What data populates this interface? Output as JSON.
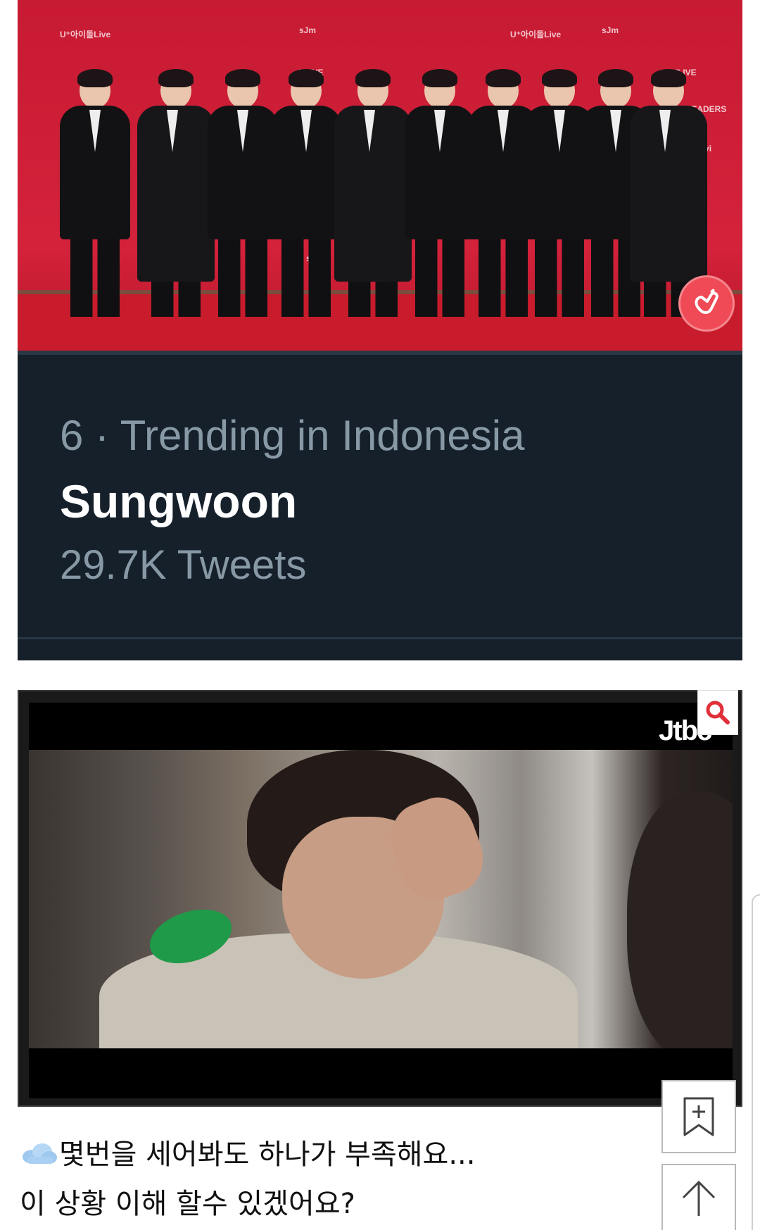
{
  "image1": {
    "backdrop_logos": [
      "sJm",
      "U⁺아이돌Live",
      "VLIVE",
      "Golden Disc Awards",
      "LEADERS",
      "Paravi",
      "ttt"
    ],
    "heart_button_icon": "finger-heart-icon"
  },
  "trending": {
    "rank_location": "6 · Trending in Indonesia",
    "topic": "Sungwoon",
    "count": "29.7K Tweets"
  },
  "image2": {
    "broadcaster_logo": "Jtbc",
    "zoom_icon": "search-icon"
  },
  "caption": {
    "line1": "몇번을 세어봐도 하나가 부족해요...",
    "line2": "이 상황 이해 할수 있겠어요?",
    "emoji": "cloud-icon"
  },
  "side_buttons": {
    "bookmark_icon": "bookmark-add-icon",
    "top_icon": "arrow-up-icon"
  },
  "colors": {
    "carpet_red": "#d4223b",
    "twitter_dark": "#15202b",
    "muted_text": "#8899a6",
    "heart_button": "#ef4a55",
    "zoom_icon": "#e0303a"
  }
}
